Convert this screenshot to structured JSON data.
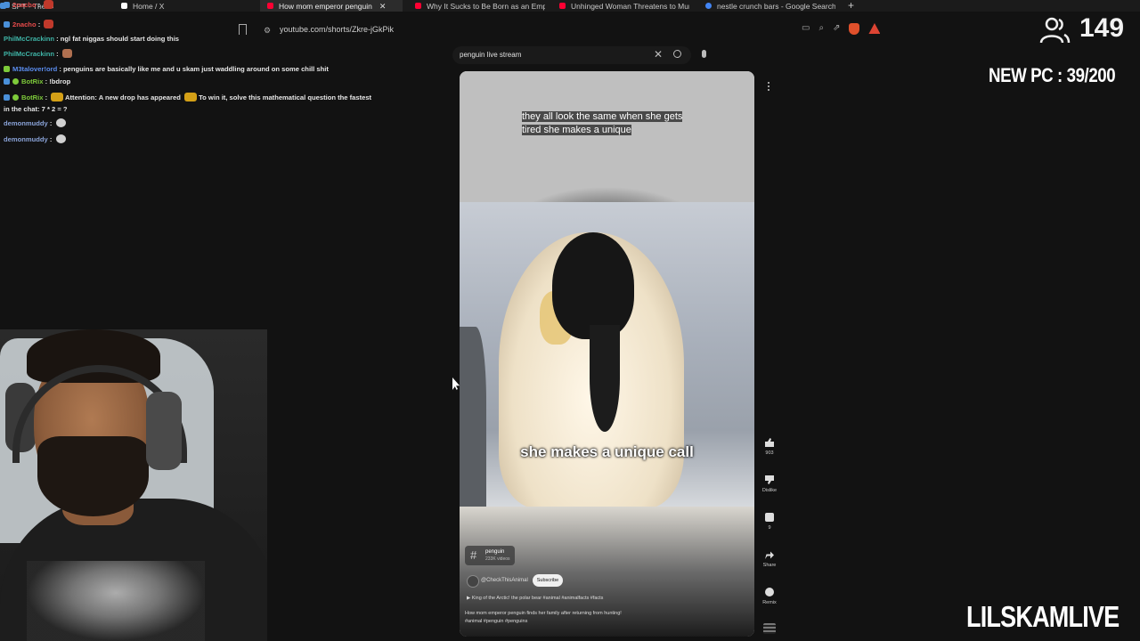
{
  "browser": {
    "tabs": [
      {
        "label": "SPT - The Forest",
        "color": "#4a90d9"
      },
      {
        "label": "Home / X",
        "color": "#ffffff"
      },
      {
        "label": "How mom emperor penguin",
        "color": "#ff0033",
        "active": true
      },
      {
        "label": "Why It Sucks to Be Born as an Emper",
        "color": "#ff0033"
      },
      {
        "label": "Unhinged Woman Threatens to Mur",
        "color": "#ff0033"
      },
      {
        "label": "nestle crunch bars - Google Search",
        "color": "#4285f4"
      }
    ],
    "new_tab": "+",
    "close": "✕",
    "url": "youtube.com/shorts/Zkre-jGkPik"
  },
  "chat": [
    {
      "user": "2nacho",
      "text": "",
      "color": "#e94b4b",
      "emote": true
    },
    {
      "user": "2nacho",
      "text": "",
      "color": "#e94b4b",
      "emote": true
    },
    {
      "user": "PhilMcCrackinn",
      "text": "ngl fat niggas should start doing this",
      "color": "#3fb6a8"
    },
    {
      "user": "PhilMcCrackinn",
      "text": "",
      "color": "#3fb6a8",
      "emote": true
    },
    {
      "user": "M3talover!ord",
      "text": "penguins are basically like me and u skam just waddling around on some chill shit",
      "color": "#5b8def"
    },
    {
      "user": "BotRix",
      "text": "!bdrop",
      "color": "#7ecb3a"
    },
    {
      "user": "BotRix",
      "text": "Attention: A new drop has appeared",
      "text2": "To win it, solve this mathematical question the fastest",
      "color": "#7ecb3a"
    },
    {
      "user": "",
      "text": "in the chat: 7 * 2 = ?",
      "color": "#e6e6e6"
    },
    {
      "user": "demonmuddy",
      "text": "",
      "color": "#8aa3d8",
      "emote": true
    },
    {
      "user": "demonmuddy",
      "text": "",
      "color": "#8aa3d8",
      "emote": true
    }
  ],
  "overlay": {
    "viewer_count": "149",
    "new_pc": "NEW PC : 39/200",
    "brand": "LILSKAMLIVE"
  },
  "youtube": {
    "search_value": "penguin live stream",
    "caption_top": "they all look the same when she gets tired she makes a unique",
    "caption_mid": "she makes a unique call",
    "hashtag": {
      "name": "penguin",
      "count": "233K videos"
    },
    "channel": "@CheckThisAnimal",
    "subscribe": "Subscribe",
    "song": "King of the Arctic! the polar bear #animal #animalfacts #facts",
    "desc_line1": "How mom emperor penguin finds her family after returning from hunting!",
    "desc_line2": "#animal #penguin #penguins",
    "actions": {
      "like_count": "903",
      "dislike": "Dislike",
      "comments": "9",
      "share": "Share",
      "remix": "Remix"
    }
  }
}
